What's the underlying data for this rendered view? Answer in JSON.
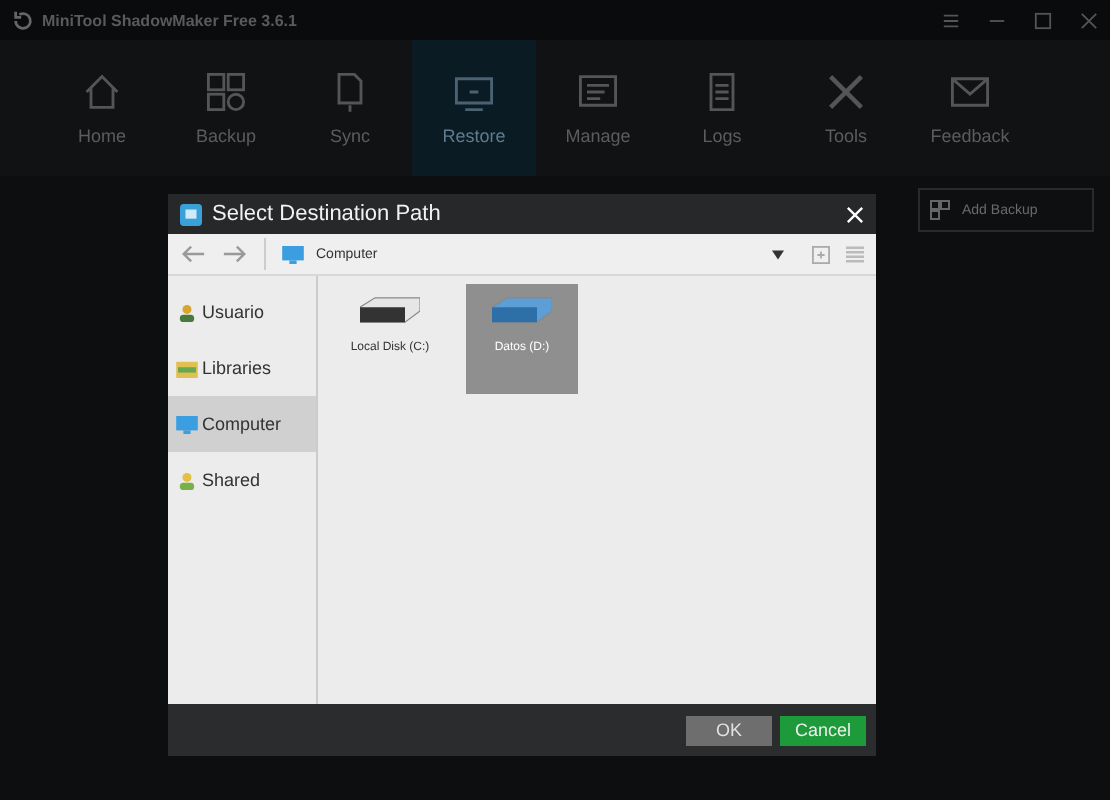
{
  "window": {
    "title": "MiniTool ShadowMaker Free 3.6.1"
  },
  "nav": [
    {
      "label": "Home",
      "selected": false
    },
    {
      "label": "Backup",
      "selected": false
    },
    {
      "label": "Sync",
      "selected": false
    },
    {
      "label": "Restore",
      "selected": true
    },
    {
      "label": "Manage",
      "selected": false
    },
    {
      "label": "Logs",
      "selected": false
    },
    {
      "label": "Tools",
      "selected": false
    },
    {
      "label": "Feedback",
      "selected": false
    }
  ],
  "add_button": {
    "label": "Add Backup"
  },
  "dialog": {
    "title": "Select Destination Path",
    "path": "Computer",
    "sidebar": [
      {
        "label": "Usuario",
        "selected": false
      },
      {
        "label": "Libraries",
        "selected": false
      },
      {
        "label": "Computer",
        "selected": true
      },
      {
        "label": "Shared",
        "selected": false
      }
    ],
    "drives": [
      {
        "label": "Local Disk (C:)",
        "selected": false
      },
      {
        "label": "Datos (D:)",
        "selected": true
      }
    ],
    "buttons": [
      {
        "label": "OK",
        "kind": "primary"
      },
      {
        "label": "Cancel",
        "kind": "cancel"
      }
    ]
  }
}
